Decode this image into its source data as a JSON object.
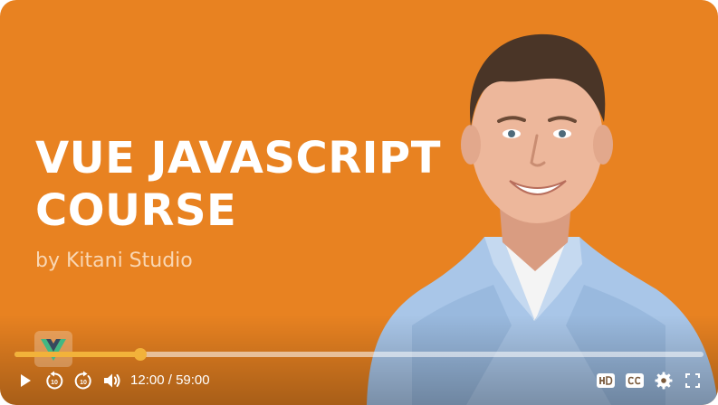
{
  "video": {
    "title_line1": "VUE JAVASCRIPT",
    "title_line2": "COURSE",
    "subtitle": "by Kitani Studio"
  },
  "player": {
    "current_time": "12:00",
    "separator": "/",
    "duration": "59:00",
    "progress_fraction": 0.183
  },
  "colors": {
    "background": "#E88221",
    "accent": "#F2B23A",
    "title_text": "#FFFFFF",
    "subtitle_text": "#F9D7B4"
  },
  "icons": {
    "play": "play-icon",
    "rewind": "rewind-10-icon",
    "forward": "forward-10-icon",
    "volume": "volume-icon",
    "hd": "hd-icon",
    "captions": "cc-icon",
    "settings": "gear-icon",
    "fullscreen": "fullscreen-icon",
    "logo": "vue-logo-icon"
  }
}
